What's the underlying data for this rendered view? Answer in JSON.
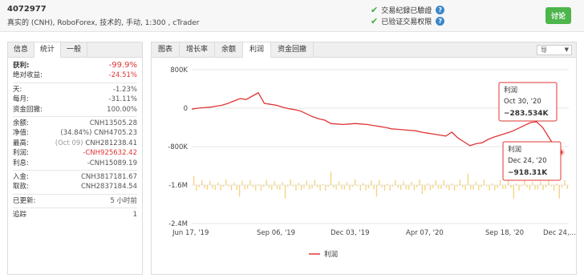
{
  "header": {
    "account_id": "4072977",
    "account_info": "真实的 (CNH), RoboForex, 技术的, 手动, 1:300 , cTrader",
    "verify1": "交易纪録已驗證",
    "verify2": "已验证交易权限",
    "discuss": "讨论"
  },
  "left": {
    "tabs": [
      "信息",
      "统计",
      "一般"
    ],
    "rows1": [
      {
        "label": "获利:",
        "value": "-99.9%"
      },
      {
        "label": "绝对收益:",
        "value": "-24.51%"
      }
    ],
    "rows2": [
      {
        "label": "天:",
        "value": "-1.23%"
      },
      {
        "label": "每月:",
        "value": "-31.11%"
      },
      {
        "label": "资金回撤:",
        "value": "100.00%"
      }
    ],
    "rows3": [
      {
        "label": "余额:",
        "value": "CNH13505.28"
      },
      {
        "label": "净值:",
        "value": "(34.84%) CNH4705.23"
      },
      {
        "label": "最高:",
        "value_grey": "(Oct 09)",
        "value": "CNH281238.41"
      },
      {
        "label": "利润:",
        "value": "-CNH925632.42"
      },
      {
        "label": "利息:",
        "value": "-CNH15089.19"
      }
    ],
    "rows4": [
      {
        "label": "入金:",
        "value": "CNH3817181.67"
      },
      {
        "label": "取款:",
        "value": "CNH2837184.54"
      }
    ],
    "rows5": [
      {
        "label": "已更新:",
        "value": "5 小时前"
      },
      {
        "label": "追踪",
        "value": "1"
      }
    ]
  },
  "chart_tabs": [
    "图表",
    "增长率",
    "余额",
    "利润",
    "资金回撤"
  ],
  "dropdown": "导",
  "chart_data": {
    "type": "line",
    "y_ticks": [
      "800K",
      "0",
      "-800K",
      "-1.6M",
      "-2.4M"
    ],
    "y_values": [
      800000,
      0,
      -800000,
      -1600000,
      -2400000
    ],
    "ylim": [
      -2400000,
      800000
    ],
    "x_ticks": [
      "Jun 17, '19",
      "Sep 06, '19",
      "Dec 03, '19",
      "Apr 07, '20",
      "Sep 18, '20",
      "Dec 24,..."
    ],
    "series": [
      {
        "name": "利润",
        "color": "#e03535",
        "values": [
          -20000,
          0,
          10000,
          20000,
          40000,
          60000,
          100000,
          150000,
          200000,
          180000,
          250000,
          320000,
          100000,
          80000,
          60000,
          20000,
          -10000,
          -30000,
          -60000,
          -120000,
          -180000,
          -220000,
          -250000,
          -320000,
          -330000,
          -340000,
          -330000,
          -320000,
          -330000,
          -340000,
          -360000,
          -380000,
          -400000,
          -430000,
          -440000,
          -450000,
          -460000,
          -470000,
          -500000,
          -520000,
          -540000,
          -560000,
          -580000,
          -500000,
          -620000,
          -700000,
          -780000,
          -740000,
          -720000,
          -650000,
          -600000,
          -560000,
          -520000,
          -480000,
          -420000,
          -360000,
          -300000,
          -283534,
          -400000,
          -600000,
          -800000,
          -918310
        ]
      }
    ],
    "tooltips": [
      {
        "title": "利润",
        "date": "Oct 30, '20",
        "value": "−283.534K"
      },
      {
        "title": "利润",
        "date": "Dec 24, '20",
        "value": "−918.31K"
      }
    ],
    "legend": "利润"
  }
}
